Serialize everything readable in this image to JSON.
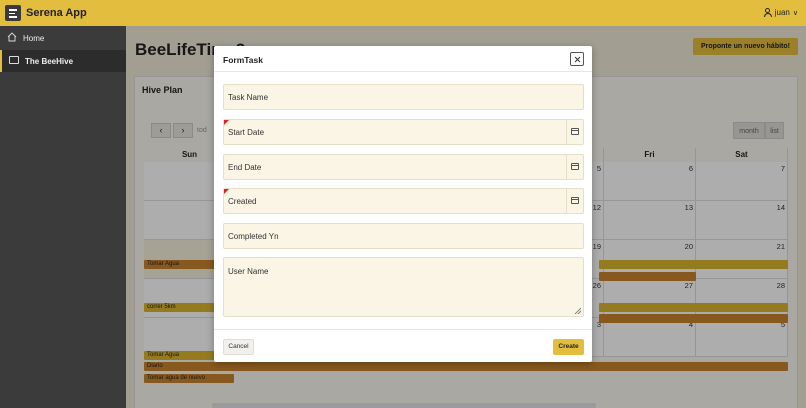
{
  "app": {
    "title": "Serena App",
    "user": "juan"
  },
  "sidebar": {
    "items": [
      {
        "label": "Home"
      },
      {
        "label": "The BeeHive"
      }
    ]
  },
  "page": {
    "title": "BeeLifeTime2",
    "propose_label": "Proponte un nuevo hábito!"
  },
  "hive": {
    "title": "Hive Plan",
    "prev_label": "‹",
    "next_label": "›",
    "today_label": "tod",
    "month_label": "month",
    "list_label": "list",
    "days": [
      "Sun",
      "",
      "",
      "",
      "",
      "Fri",
      "Sat"
    ],
    "dates": [
      [
        "",
        "",
        "",
        "",
        "5",
        "6",
        "7"
      ],
      [
        "",
        "",
        "",
        "",
        "12",
        "13",
        "14"
      ],
      [
        "",
        "",
        "",
        "",
        "19",
        "20",
        "21"
      ],
      [
        "",
        "",
        "",
        "",
        "26",
        "27",
        "28"
      ],
      [
        "",
        "",
        "",
        "",
        "3",
        "4",
        "5"
      ]
    ],
    "events": [
      {
        "label": "Tomar Agua",
        "color": "#c9832d"
      },
      {
        "label": "",
        "color": "#dcb52f"
      },
      {
        "label": "",
        "color": "#c9832d"
      },
      {
        "label": "correr 5km",
        "color": "#dcb52f"
      },
      {
        "label": "",
        "color": "#dcb52f"
      },
      {
        "label": "",
        "color": "#c9832d"
      },
      {
        "label": "Tomar Agua",
        "color": "#dcb52f"
      },
      {
        "label": "Diario",
        "color": "#c9832d"
      },
      {
        "label": "Tomar agua de nuevo",
        "color": "#c9832d"
      }
    ]
  },
  "modal": {
    "title": "FormTask",
    "fields": {
      "task_name": "Task Name",
      "start_date": "Start Date",
      "end_date": "End Date",
      "created": "Created",
      "completed": "Completed Yn",
      "user_name": "User Name"
    },
    "cancel_label": "Cancel",
    "create_label": "Create"
  },
  "colors": {
    "accent": "#e3bd3e",
    "sidebar": "#3b3b3b",
    "field": "#faf5e4"
  }
}
